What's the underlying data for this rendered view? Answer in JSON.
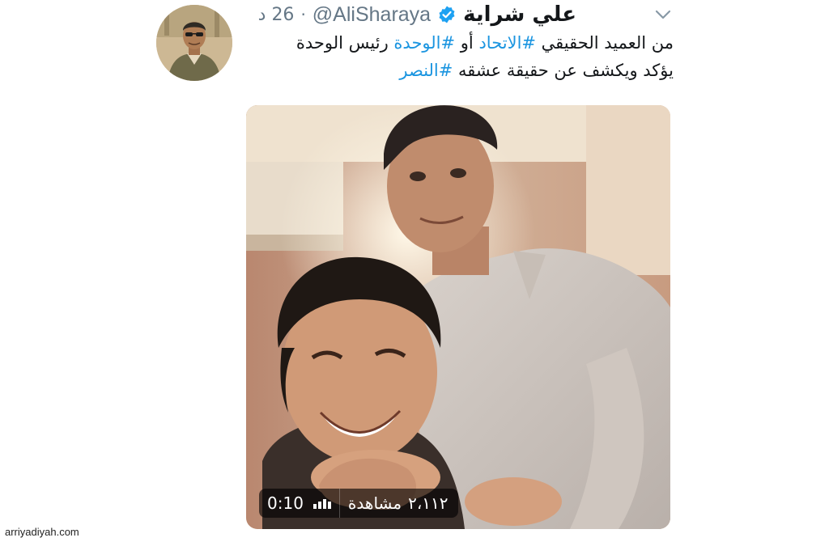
{
  "tweet": {
    "display_name": "علي شراية",
    "handle": "@AliSharaya",
    "separator": "·",
    "time": "26 د",
    "text_lines": [
      [
        {
          "t": "من العميد الحقيقي ",
          "h": false
        },
        {
          "t": "#الاتحاد",
          "h": true
        },
        {
          "t": " أو ",
          "h": false
        },
        {
          "t": "#الوحدة",
          "h": true
        },
        {
          "t": " رئيس الوحدة",
          "h": false
        }
      ],
      [
        {
          "t": "يؤكد ويكشف عن حقيقة عشقه ",
          "h": false
        },
        {
          "t": "#النصر",
          "h": true
        }
      ]
    ]
  },
  "media": {
    "duration": "0:10",
    "views_count": "٢،١١٢",
    "views_label": "مشاهدة"
  },
  "icons": {
    "verified": "verified-badge-icon",
    "caret": "chevron-down-icon",
    "volume": "audio-bars-icon"
  },
  "colors": {
    "hashtag": "#1b95e0",
    "verified": "#1da1f2",
    "muted": "#657786",
    "text": "#14171a"
  },
  "watermark": "arriyadiyah.com"
}
